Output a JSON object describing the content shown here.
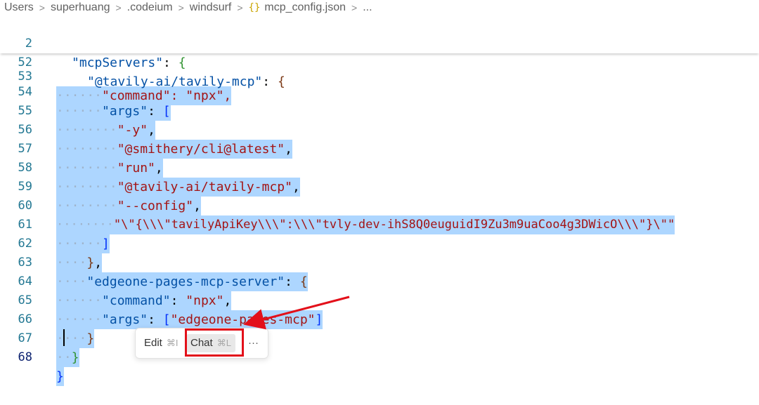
{
  "breadcrumb": {
    "items": [
      "Users",
      "superhuang",
      ".codeium",
      "windsurf",
      "mcp_config.json",
      "..."
    ],
    "file_icon": "{}"
  },
  "sticky": [
    {
      "num": "2",
      "key": "\"mcpServers\"",
      "colon": ": ",
      "brace": "{"
    },
    {
      "num": "52",
      "key": "\"@tavily-ai/tavily-mcp\"",
      "colon": ": ",
      "brace": "{"
    }
  ],
  "lines": {
    "l53": {
      "num": "53",
      "text": "\"command\": \"npx\","
    },
    "l54": {
      "num": "54",
      "key": "\"args\"",
      "rest": ": ",
      "bracket": "["
    },
    "l55": {
      "num": "55",
      "str": "\"-y\"",
      "comma": ","
    },
    "l56": {
      "num": "56",
      "str": "\"@smithery/cli@latest\"",
      "comma": ","
    },
    "l57": {
      "num": "57",
      "str": "\"run\"",
      "comma": ","
    },
    "l58": {
      "num": "58",
      "str": "\"@tavily-ai/tavily-mcp\"",
      "comma": ","
    },
    "l59": {
      "num": "59",
      "str": "\"--config\"",
      "comma": ","
    },
    "l60": {
      "num": "60",
      "str": "\"\\\"{\\\\\\\"tavilyApiKey\\\\\\\":\\\\\\\"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\\\\\\\"}\\\"\""
    },
    "l61": {
      "num": "61",
      "bracket": "]"
    },
    "l62": {
      "num": "62",
      "brace": "}",
      "comma": ","
    },
    "l63": {
      "num": "63",
      "key": "\"edgeone-pages-mcp-server\"",
      "rest": ": ",
      "brace": "{"
    },
    "l64": {
      "num": "64",
      "key": "\"command\"",
      "rest": ": ",
      "str": "\"npx\"",
      "comma": ","
    },
    "l65": {
      "num": "65",
      "key": "\"args\"",
      "rest": ": ",
      "bopen": "[",
      "str": "\"edgeone-pages-mcp\"",
      "bclose": "]"
    },
    "l66": {
      "num": "66",
      "brace": "}"
    },
    "l67": {
      "num": "67",
      "brace": "}"
    },
    "l68": {
      "num": "68",
      "brace": "}"
    }
  },
  "widget": {
    "edit_label": "Edit",
    "edit_shortcut": "⌘I",
    "chat_label": "Chat",
    "chat_shortcut": "⌘L",
    "more_label": "···"
  },
  "colors": {
    "selection": "#add6ff",
    "annotation": "#e3101a",
    "key": "#0451a5",
    "string": "#a31515"
  }
}
